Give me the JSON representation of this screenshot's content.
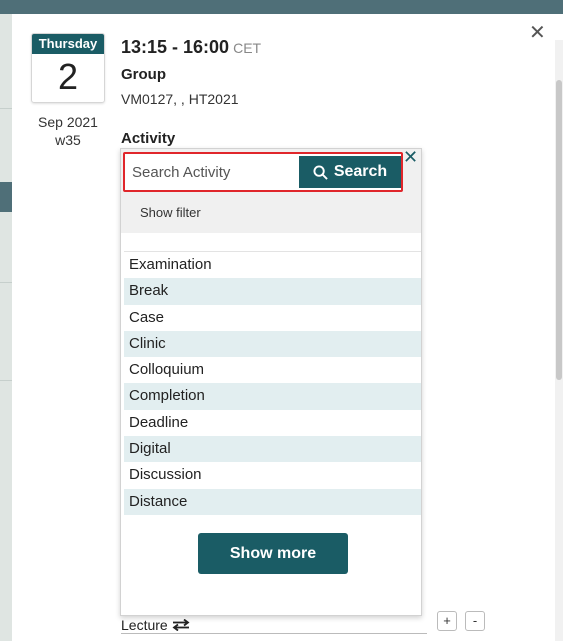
{
  "event": {
    "weekday": "Thursday",
    "day": "2",
    "month_year": "Sep 2021",
    "week": "w35",
    "time": "13:15 - 16:00",
    "timezone": "CET"
  },
  "group": {
    "label": "Group",
    "value": "VM0127, , HT2021"
  },
  "activity": {
    "label": "Activity",
    "search": {
      "placeholder": "Search Activity",
      "button_label": "Search",
      "close_glyph": "✕"
    },
    "show_filter_label": "Show filter",
    "items": [
      "Examination",
      "Break",
      "Case",
      "Clinic",
      "Colloquium",
      "Completion",
      "Deadline",
      "Digital",
      "Discussion",
      "Distance"
    ],
    "show_more_label": "Show more"
  },
  "lecture": {
    "label": "Lecture",
    "icon": "swap-arrows-icon"
  },
  "buttons": {
    "plus_label": "+",
    "minus_label": "-"
  },
  "dialog": {
    "close_glyph": "✕"
  },
  "colors": {
    "accent": "#1a5c65",
    "highlight": "#e0262b",
    "row_alt": "#e2eef0"
  }
}
